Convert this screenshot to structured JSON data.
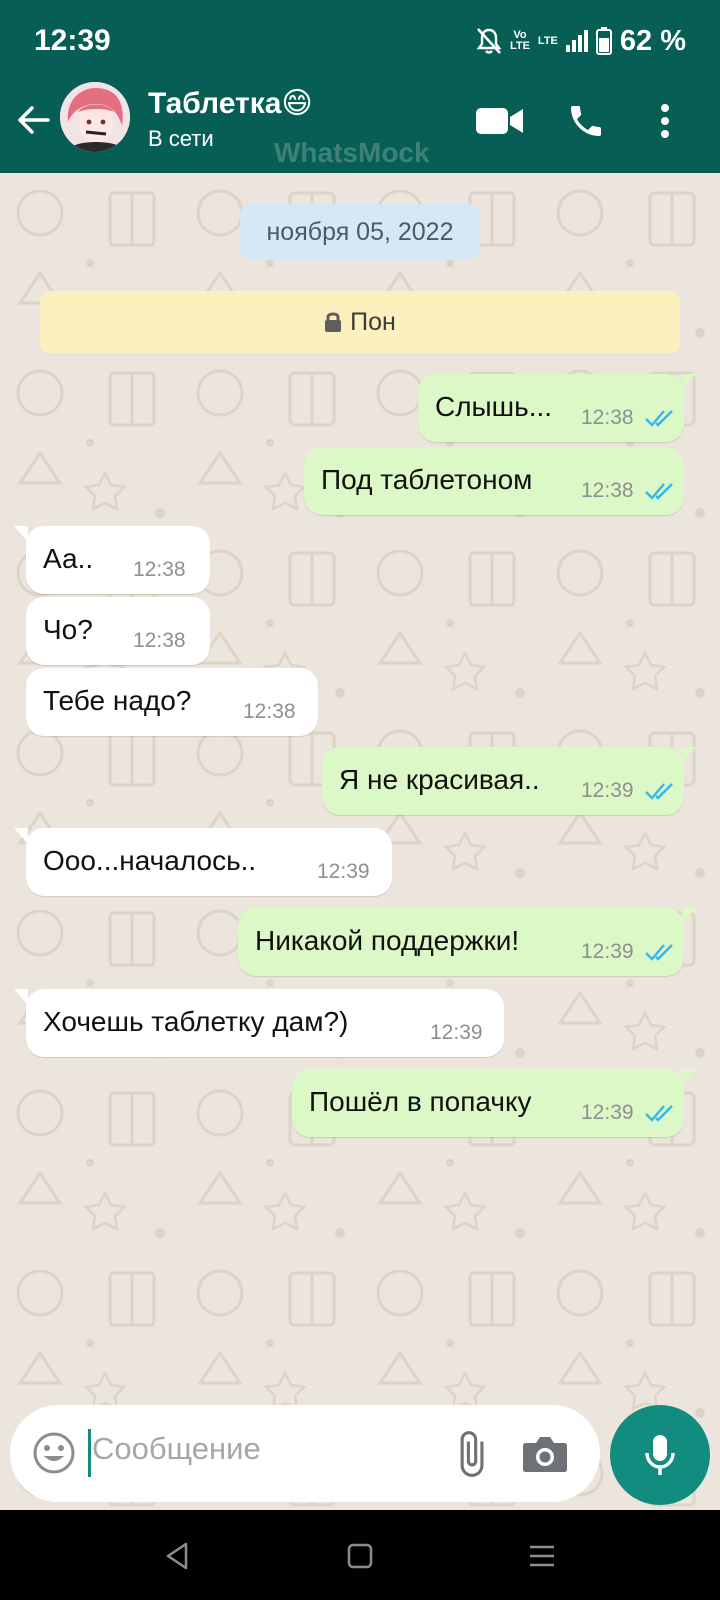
{
  "status_bar": {
    "time": "12:39",
    "network_top": "Vo",
    "network_bottom": "LTE",
    "lte": "LTE",
    "battery": "62 %"
  },
  "header": {
    "contact_name": "Таблетка😄",
    "status": "В сети",
    "watermark": "WhatsMock"
  },
  "chat": {
    "date": "ноября 05, 2022",
    "notice": "Пон",
    "messages": [
      {
        "dir": "out",
        "text": "Слышь...",
        "time": "12:38",
        "read": true
      },
      {
        "dir": "out",
        "text": "Под таблетоном",
        "time": "12:38",
        "read": true
      },
      {
        "dir": "in",
        "text": "Аа..",
        "time": "12:38"
      },
      {
        "dir": "in",
        "text": "Чо?",
        "time": "12:38"
      },
      {
        "dir": "in",
        "text": "Тебе надо?",
        "time": "12:38"
      },
      {
        "dir": "out",
        "text": "Я не красивая..",
        "time": "12:39",
        "read": true
      },
      {
        "dir": "in",
        "text": "Ооо...началось..",
        "time": "12:39"
      },
      {
        "dir": "out",
        "text": "Никакой поддержки!",
        "time": "12:39",
        "read": true
      },
      {
        "dir": "in",
        "text": "Хочешь таблетку дам?)",
        "time": "12:39"
      },
      {
        "dir": "out",
        "text": "Пошёл в попачку",
        "time": "12:39",
        "read": true
      }
    ]
  },
  "composer": {
    "placeholder": "Сообщение"
  },
  "colors": {
    "header": "#075e54",
    "accent": "#128c7e",
    "outgoing": "#dcf8c6",
    "incoming": "#ffffff",
    "read_ticks": "#34b7f1",
    "chat_bg": "#ece5dd"
  }
}
